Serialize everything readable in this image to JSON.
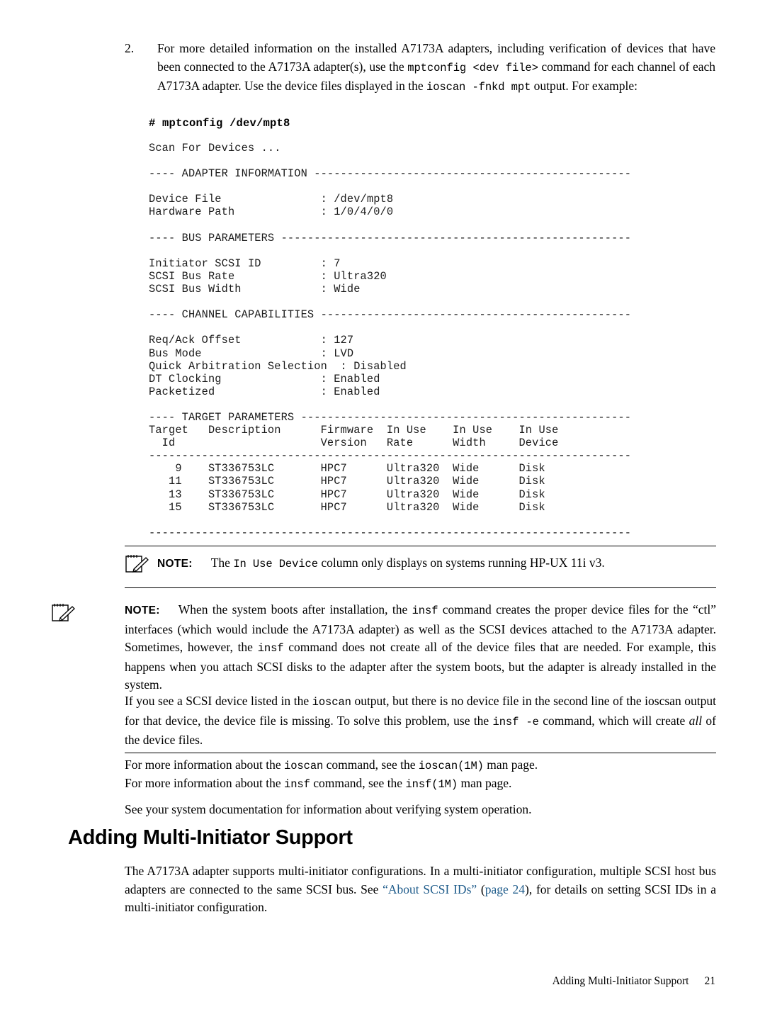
{
  "step": {
    "number": "2.",
    "text_part1": "For more detailed information on the installed A7173A adapters, including verification of devices that have been connected to the A7173A adapter(s), use the ",
    "cmd1": "mptconfig <dev file>",
    "text_part2": " command for each channel of each A7173A adapter. Use the device files displayed in the ",
    "cmd2": "ioscan -fnkd mpt",
    "text_part3": " output. For example:"
  },
  "terminal": {
    "prompt_line": "# mptconfig /dev/mpt8",
    "output": "Scan For Devices ...\n\n---- ADAPTER INFORMATION ------------------------------------------------\n\nDevice File               : /dev/mpt8\nHardware Path             : 1/0/4/0/0\n\n---- BUS PARAMETERS -----------------------------------------------------\n\nInitiator SCSI ID         : 7\nSCSI Bus Rate             : Ultra320\nSCSI Bus Width            : Wide\n\n---- CHANNEL CAPABILITIES -----------------------------------------------\n\nReq/Ack Offset            : 127\nBus Mode                  : LVD\nQuick Arbitration Selection  : Disabled\nDT Clocking               : Enabled\nPacketized                : Enabled\n\n---- TARGET PARAMETERS --------------------------------------------------\nTarget   Description      Firmware  In Use    In Use    In Use\n  Id                      Version   Rate      Width     Device\n-------------------------------------------------------------------------\n    9    ST336753LC       HPC7      Ultra320  Wide      Disk\n   11    ST336753LC       HPC7      Ultra320  Wide      Disk\n   13    ST336753LC       HPC7      Ultra320  Wide      Disk\n   15    ST336753LC       HPC7      Ultra320  Wide      Disk\n\n-------------------------------------------------------------------------"
  },
  "note1": {
    "label": "NOTE:",
    "text_a": "The ",
    "mono": "In Use Device",
    "text_b": " column only displays on systems running HP-UX 11i v3."
  },
  "note2": {
    "label": "NOTE:",
    "p1_a": "When the system boots after installation, the ",
    "p1_mono1": "insf",
    "p1_b": " command creates the proper device files for the “ctl” interfaces (which would include the A7173A adapter) as well as the SCSI devices attached to the A7173A adapter. Sometimes, however, the ",
    "p1_mono2": "insf",
    "p1_c": " command does not create all of the device files that are needed. For example, this happens when you attach SCSI disks to the adapter after the system boots, but the adapter is already installed in the system.",
    "p2_a": "If you see a SCSI device listed in the ",
    "p2_mono1": "ioscan",
    "p2_b": " output, but there is no device file in the second line of the ioscsan output for that device, the device file is missing. To solve this problem, use the ",
    "p2_mono2": "insf -e",
    "p2_c": " command, which will create ",
    "p2_italic": "all",
    "p2_d": " of the device files."
  },
  "paragraphs": {
    "p1_a": "For more information about the ",
    "p1_mono1": "ioscan",
    "p1_b": " command, see the ",
    "p1_mono2": "ioscan",
    "p1_c": "(1M)",
    "p1_d": " man page.",
    "p2_a": "For more information about the ",
    "p2_mono1": "insf",
    "p2_b": " command, see the ",
    "p2_mono2": "insf",
    "p2_c": "(1M)",
    "p2_d": " man page.",
    "p3": "See your system documentation for information about verifying system operation."
  },
  "heading": "Adding Multi-Initiator Support",
  "section_body": {
    "a": "The A7173A adapter supports multi-initiator configurations. In a multi-initiator configuration, multiple SCSI host bus adapters are connected to the same SCSI bus. See ",
    "link1": "“About SCSI IDs”",
    "b": " (",
    "link2": "page 24",
    "c": "), for details on setting SCSI IDs in a multi-initiator configuration."
  },
  "footer": {
    "title": "Adding Multi-Initiator Support",
    "page": "21"
  }
}
